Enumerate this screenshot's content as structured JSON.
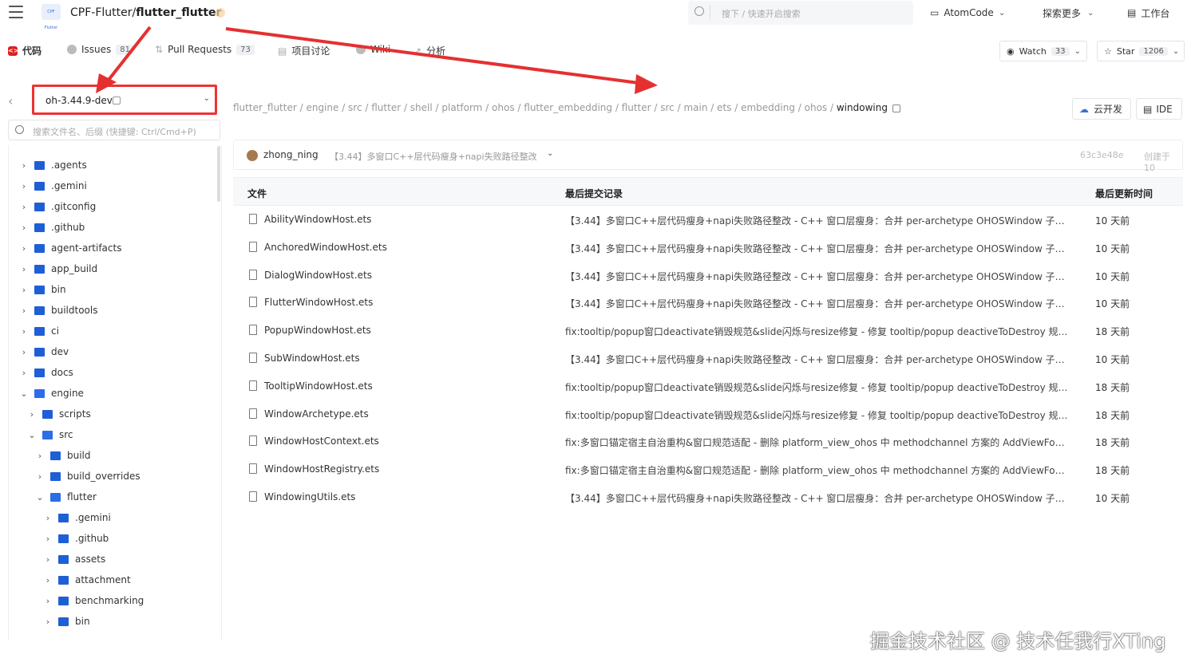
{
  "topbar": {
    "repo_owner": "CPF-Flutter/",
    "repo_name": "flutter_flutter",
    "logo_text": "CPF Flutter",
    "search_placeholder": "搜下  /  快速开启搜索",
    "atomcode_label": "AtomCode",
    "explore_label": "探索更多",
    "workbench_label": "工作台"
  },
  "tabs": [
    {
      "label": "代码",
      "count": ""
    },
    {
      "label": "Issues",
      "count": "81"
    },
    {
      "label": "Pull Requests",
      "count": "73"
    },
    {
      "label": "项目讨论",
      "count": ""
    },
    {
      "label": "Wiki",
      "count": ""
    },
    {
      "label": "分析",
      "count": ""
    }
  ],
  "watch": {
    "label": "Watch",
    "count": "33"
  },
  "star": {
    "label": "Star",
    "count": "1206"
  },
  "branch": "oh-3.44.9-dev",
  "file_search_placeholder": "搜索文件名、后缀 (快捷键: Ctrl/Cmd+P)",
  "tree": [
    {
      "label": ".agents",
      "level": 0,
      "open": false
    },
    {
      "label": ".gemini",
      "level": 0,
      "open": false
    },
    {
      "label": ".gitconfig",
      "level": 0,
      "open": false
    },
    {
      "label": ".github",
      "level": 0,
      "open": false
    },
    {
      "label": "agent-artifacts",
      "level": 0,
      "open": false
    },
    {
      "label": "app_build",
      "level": 0,
      "open": false
    },
    {
      "label": "bin",
      "level": 0,
      "open": false
    },
    {
      "label": "buildtools",
      "level": 0,
      "open": false
    },
    {
      "label": "ci",
      "level": 0,
      "open": false
    },
    {
      "label": "dev",
      "level": 0,
      "open": false
    },
    {
      "label": "docs",
      "level": 0,
      "open": false
    },
    {
      "label": "engine",
      "level": 0,
      "open": true
    },
    {
      "label": "scripts",
      "level": 1,
      "open": false
    },
    {
      "label": "src",
      "level": 1,
      "open": true
    },
    {
      "label": "build",
      "level": 2,
      "open": false
    },
    {
      "label": "build_overrides",
      "level": 2,
      "open": false
    },
    {
      "label": "flutter",
      "level": 2,
      "open": true
    },
    {
      "label": ".gemini",
      "level": 3,
      "open": false
    },
    {
      "label": ".github",
      "level": 3,
      "open": false
    },
    {
      "label": "assets",
      "level": 3,
      "open": false
    },
    {
      "label": "attachment",
      "level": 3,
      "open": false
    },
    {
      "label": "benchmarking",
      "level": 3,
      "open": false
    },
    {
      "label": "bin",
      "level": 3,
      "open": false
    }
  ],
  "breadcrumb": {
    "path": "flutter_flutter / engine / src / flutter / shell / platform / ohos / flutter_embedding / flutter / src / main / ets / embedding / ohos / ",
    "current": "windowing"
  },
  "cloud_dev_label": "云开发",
  "ide_label": "IDE",
  "commit": {
    "author": "zhong_ning",
    "message": "【3.44】多窗口C++层代码瘦身+napi失败路径整改",
    "hash": "63c3e48e",
    "created": "创建于 10"
  },
  "table": {
    "headers": {
      "file": "文件",
      "commit": "最后提交记录",
      "time": "最后更新时间"
    },
    "rows": [
      {
        "name": "AbilityWindowHost.ets",
        "commit": "【3.44】多窗口C++层代码瘦身+napi失败路径整改 - C++ 窗口层瘦身：合并 per-archetype OHOSWindow 子类（anc···",
        "time": "10 天前"
      },
      {
        "name": "AnchoredWindowHost.ets",
        "commit": "【3.44】多窗口C++层代码瘦身+napi失败路径整改 - C++ 窗口层瘦身：合并 per-archetype OHOSWindow 子类（anc···",
        "time": "10 天前"
      },
      {
        "name": "DialogWindowHost.ets",
        "commit": "【3.44】多窗口C++层代码瘦身+napi失败路径整改 - C++ 窗口层瘦身：合并 per-archetype OHOSWindow 子类（anc···",
        "time": "10 天前"
      },
      {
        "name": "FlutterWindowHost.ets",
        "commit": "【3.44】多窗口C++层代码瘦身+napi失败路径整改 - C++ 窗口层瘦身：合并 per-archetype OHOSWindow 子类（anc···",
        "time": "10 天前"
      },
      {
        "name": "PopupWindowHost.ets",
        "commit": "fix:tooltip/popup窗口deactivate销毁规范&slide闪烁与resize修复 - 修复 tooltip/popup deactiveToDestroy 规范：···",
        "time": "18 天前"
      },
      {
        "name": "SubWindowHost.ets",
        "commit": "【3.44】多窗口C++层代码瘦身+napi失败路径整改 - C++ 窗口层瘦身：合并 per-archetype OHOSWindow 子类（anc···",
        "time": "10 天前"
      },
      {
        "name": "TooltipWindowHost.ets",
        "commit": "fix:tooltip/popup窗口deactivate销毁规范&slide闪烁与resize修复 - 修复 tooltip/popup deactiveToDestroy 规范：···",
        "time": "18 天前"
      },
      {
        "name": "WindowArchetype.ets",
        "commit": "fix:tooltip/popup窗口deactivate销毁规范&slide闪烁与resize修复 - 修复 tooltip/popup deactiveToDestroy 规范：···",
        "time": "18 天前"
      },
      {
        "name": "WindowHostContext.ets",
        "commit": "fix:多窗口锚定宿主自治重构&窗口规范适配 - 删除 platform_view_ohos 中 methodchannel 方案的 AddViewForWin···",
        "time": "18 天前"
      },
      {
        "name": "WindowHostRegistry.ets",
        "commit": "fix:多窗口锚定宿主自治重构&窗口规范适配 - 删除 platform_view_ohos 中 methodchannel 方案的 AddViewForWin···",
        "time": "18 天前"
      },
      {
        "name": "WindowingUtils.ets",
        "commit": "【3.44】多窗口C++层代码瘦身+napi失败路径整改 - C++ 窗口层瘦身：合并 per-archetype OHOSWindow 子类（anc···",
        "time": "10 天前"
      }
    ]
  },
  "watermark": "掘金技术社区 @ 技术任我行XTing",
  "colors": {
    "annotation_red": "#e53030",
    "folder_blue": "#1f5fd6",
    "code_tab_red": "#e02020"
  }
}
